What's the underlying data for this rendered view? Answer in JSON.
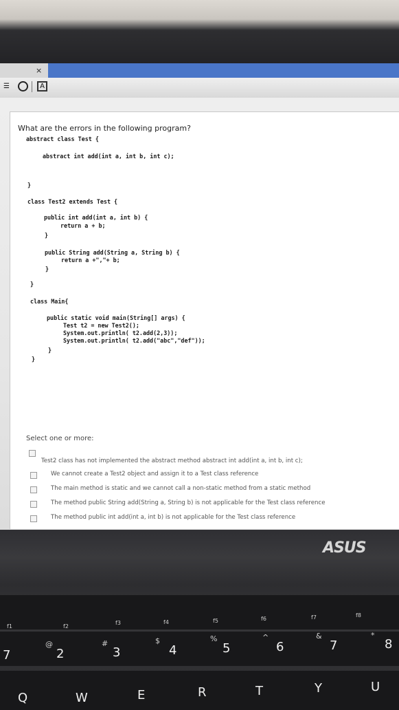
{
  "browser": {
    "close_glyph": "×",
    "icon_a": "A"
  },
  "question": {
    "text": "What are the errors in the following program?"
  },
  "code_lines": [
    "abstract class Test {",
    "abstract int add(int a, int b, int c);",
    "}",
    "class Test2 extends Test {",
    "public int add(int a, int b) {",
    "return a + b;",
    "}",
    "public String add(String a, String b) {",
    "return a +\",\"+ b;",
    "}",
    "}",
    "class Main{",
    "public static void main(String[] args) {",
    "Test t2 = new Test2();",
    "System.out.println( t2.add(2,3));",
    "System.out.println( t2.add(\"abc\",\"def\"));",
    "}",
    "}"
  ],
  "answers": {
    "label": "Select one or more:",
    "options": [
      "Test2 class has not implemented the abstract method abstract int add(int a, int b, int c);",
      "We cannot create a Test2 object and assign it to a Test class reference",
      "The main method is static and we cannot call a non-static method from a static method",
      "The method public String add(String a, String b) is not applicable for the Test class reference",
      "The method public int add(int a, int b) is not applicable for the Test class reference"
    ]
  },
  "laptop": {
    "brand": "ASUS",
    "number_keys": [
      "2",
      "3",
      "4",
      "5",
      "6",
      "7",
      "8"
    ],
    "number_symbols": [
      "@",
      "#",
      "$",
      "%",
      "^",
      "&",
      "*"
    ],
    "fn_keys": [
      "f1",
      "f2",
      "f3",
      "f4",
      "f5",
      "f6",
      "f7",
      "f8"
    ],
    "letter_keys": [
      "Q",
      "W",
      "E",
      "R",
      "T",
      "Y",
      "U"
    ],
    "left_edge_key": "7"
  }
}
